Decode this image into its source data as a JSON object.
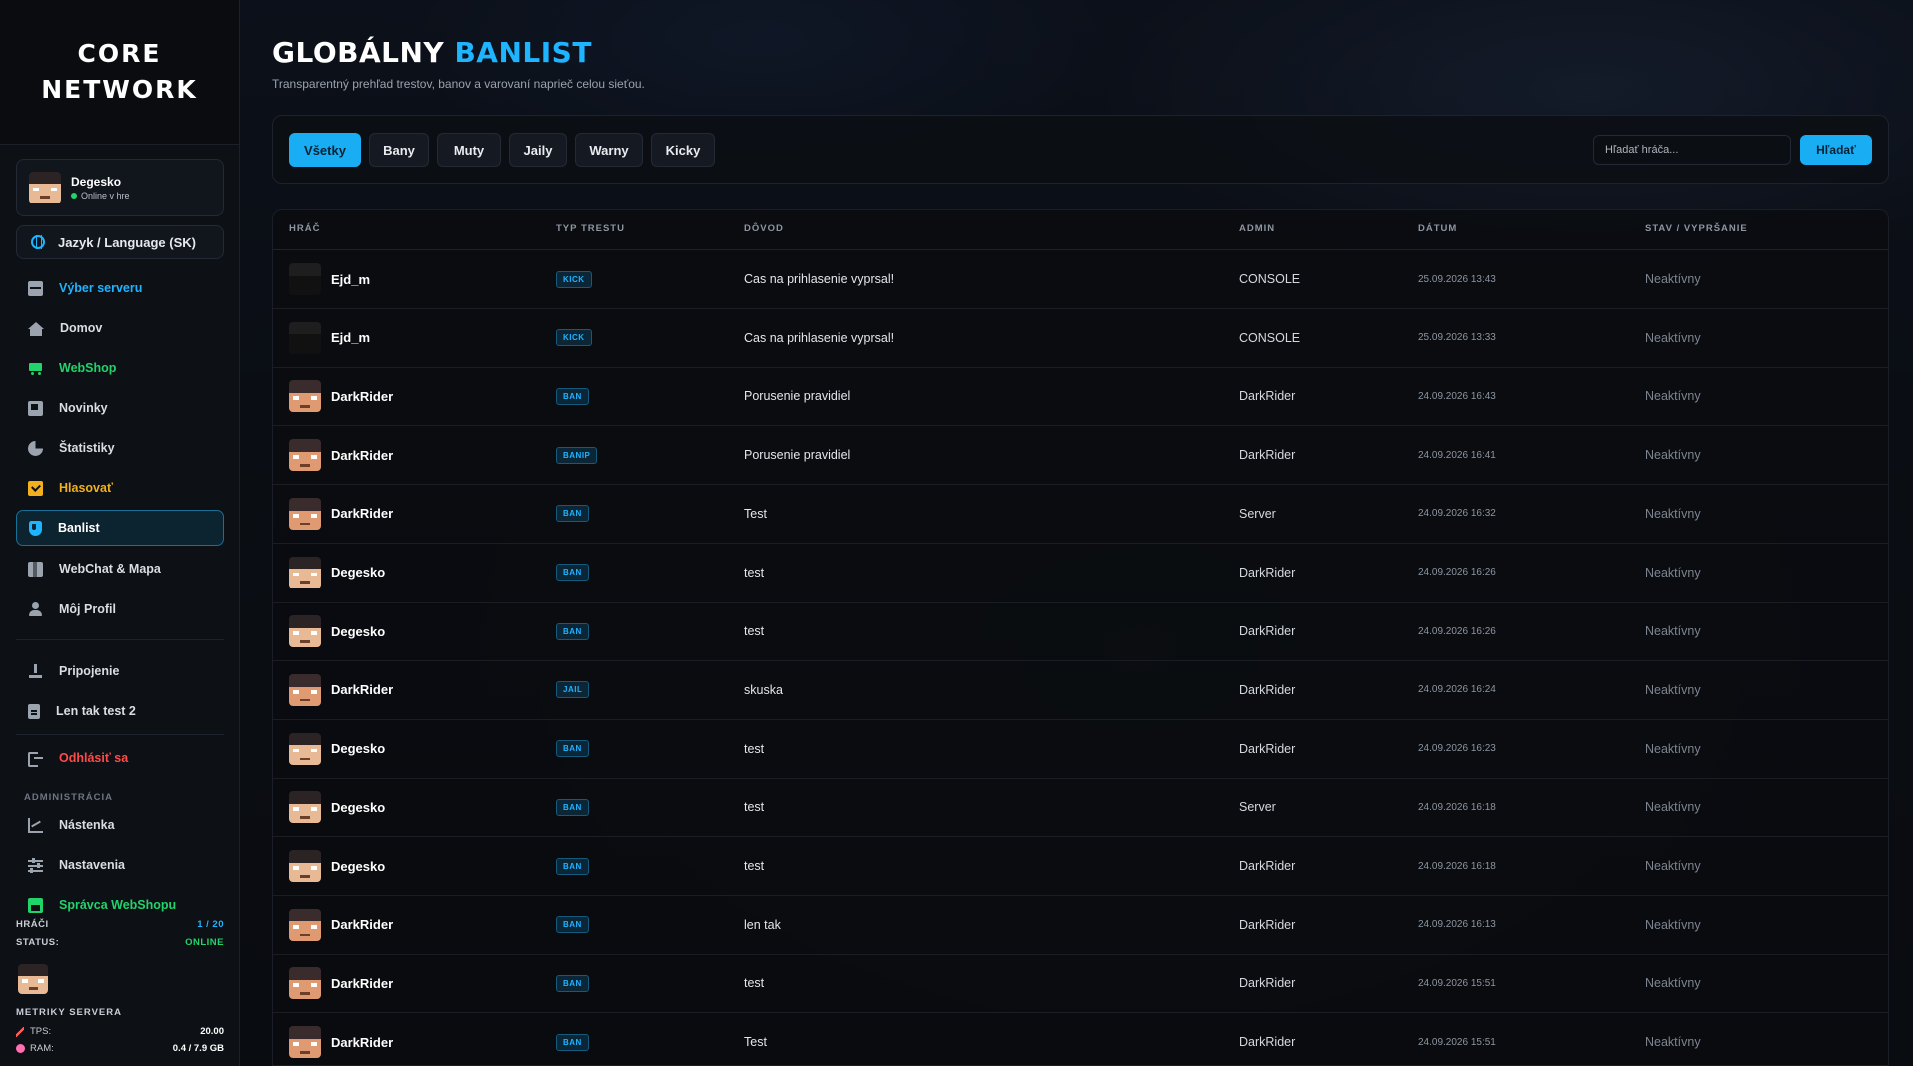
{
  "brand": {
    "line1": "CORE",
    "line2": "NETWORK"
  },
  "user": {
    "name": "Degesko",
    "status": "Online v hre",
    "status_color": "#22d36b"
  },
  "language_button": "Jazyk / Language (SK)",
  "nav": [
    {
      "label": "Výber serveru",
      "icon": "server-icon",
      "color": "#1fb4ff"
    },
    {
      "label": "Domov",
      "icon": "home-icon"
    },
    {
      "label": "WebShop",
      "icon": "cart-icon",
      "color": "#22d36b"
    },
    {
      "label": "Novinky",
      "icon": "news-icon"
    },
    {
      "label": "Štatistiky",
      "icon": "pie-chart-icon"
    },
    {
      "label": "Hlasovať",
      "icon": "vote-icon",
      "color": "#f2b01e"
    },
    {
      "label": "Banlist",
      "icon": "shield-icon",
      "active": true
    },
    {
      "label": "WebChat & Mapa",
      "icon": "map-icon"
    },
    {
      "label": "Môj Profil",
      "icon": "user-icon"
    },
    {
      "label": "Pripojenie",
      "icon": "download-icon"
    },
    {
      "label": "Len tak test 2",
      "icon": "file-icon"
    },
    {
      "label": "Odhlásiť sa",
      "icon": "logout-icon",
      "color": "#ff4a4a"
    }
  ],
  "admin": {
    "section_label": "ADMINISTRÁCIA",
    "items": [
      {
        "label": "Nástenka",
        "icon": "chart-icon"
      },
      {
        "label": "Nastavenia",
        "icon": "sliders-icon"
      },
      {
        "label": "Správca WebShopu",
        "icon": "store-icon",
        "color": "#22d36b"
      }
    ]
  },
  "server_stats": {
    "players_label": "HRÁČI",
    "players_value": "1 / 20",
    "status_label": "STATUS:",
    "status_value": "ONLINE"
  },
  "metrics": {
    "title": "METRIKY SERVERA",
    "tps_label": "TPS:",
    "tps_value": "20.00",
    "ram_label": "RAM:",
    "ram_value": "0.4 / 7.9 GB"
  },
  "page": {
    "title": "GLOBÁLNY",
    "title_accent": "BANLIST",
    "subtitle": "Transparentný prehľad trestov, banov a varovaní naprieč celou sieťou."
  },
  "filters": [
    "Všetky",
    "Bany",
    "Muty",
    "Jaily",
    "Warny",
    "Kicky"
  ],
  "search": {
    "placeholder": "Hľadať hráča...",
    "button": "Hľadať"
  },
  "table": {
    "columns": [
      "HRÁČ",
      "TYP TRESTU",
      "DÔVOD",
      "ADMIN",
      "DÁTUM",
      "STAV / VYPRŠANIE"
    ],
    "rows": [
      {
        "player": "Ejd_m",
        "skin": "dark",
        "type": "KICK",
        "reason": "Cas na prihlasenie vyprsal!",
        "admin": "CONSOLE",
        "date": "25.09.2026 13:43",
        "status": "Neaktívny"
      },
      {
        "player": "Ejd_m",
        "skin": "dark",
        "type": "KICK",
        "reason": "Cas na prihlasenie vyprsal!",
        "admin": "CONSOLE",
        "date": "25.09.2026 13:33",
        "status": "Neaktívny"
      },
      {
        "player": "DarkRider",
        "skin": "orange",
        "type": "BAN",
        "reason": "Porusenie pravidiel",
        "admin": "DarkRider",
        "date": "24.09.2026 16:43",
        "status": "Neaktívny"
      },
      {
        "player": "DarkRider",
        "skin": "orange",
        "type": "BANIP",
        "reason": "Porusenie pravidiel",
        "admin": "DarkRider",
        "date": "24.09.2026 16:41",
        "status": "Neaktívny"
      },
      {
        "player": "DarkRider",
        "skin": "orange",
        "type": "BAN",
        "reason": "Test",
        "admin": "Server",
        "date": "24.09.2026 16:32",
        "status": "Neaktívny"
      },
      {
        "player": "Degesko",
        "skin": "light",
        "type": "BAN",
        "reason": "test",
        "admin": "DarkRider",
        "date": "24.09.2026 16:26",
        "status": "Neaktívny"
      },
      {
        "player": "Degesko",
        "skin": "light",
        "type": "BAN",
        "reason": "test",
        "admin": "DarkRider",
        "date": "24.09.2026 16:26",
        "status": "Neaktívny"
      },
      {
        "player": "DarkRider",
        "skin": "orange",
        "type": "JAIL",
        "reason": "skuska",
        "admin": "DarkRider",
        "date": "24.09.2026 16:24",
        "status": "Neaktívny"
      },
      {
        "player": "Degesko",
        "skin": "light",
        "type": "BAN",
        "reason": "test",
        "admin": "DarkRider",
        "date": "24.09.2026 16:23",
        "status": "Neaktívny"
      },
      {
        "player": "Degesko",
        "skin": "light",
        "type": "BAN",
        "reason": "test",
        "admin": "Server",
        "date": "24.09.2026 16:18",
        "status": "Neaktívny"
      },
      {
        "player": "Degesko",
        "skin": "light",
        "type": "BAN",
        "reason": "test",
        "admin": "DarkRider",
        "date": "24.09.2026 16:18",
        "status": "Neaktívny"
      },
      {
        "player": "DarkRider",
        "skin": "orange",
        "type": "BAN",
        "reason": "len tak",
        "admin": "DarkRider",
        "date": "24.09.2026 16:13",
        "status": "Neaktívny"
      },
      {
        "player": "DarkRider",
        "skin": "orange",
        "type": "BAN",
        "reason": "test",
        "admin": "DarkRider",
        "date": "24.09.2026 15:51",
        "status": "Neaktívny"
      },
      {
        "player": "DarkRider",
        "skin": "orange",
        "type": "BAN",
        "reason": "Test",
        "admin": "DarkRider",
        "date": "24.09.2026 15:51",
        "status": "Neaktívny"
      }
    ]
  }
}
